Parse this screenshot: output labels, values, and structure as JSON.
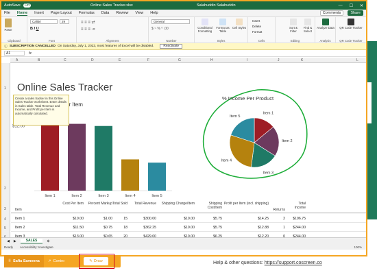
{
  "titlebar": {
    "autosave": "AutoSave",
    "autosave_state": "Off",
    "filename": "Online Sales Tracker.xlsx",
    "user": "Salahuddin Salahuddin"
  },
  "tabs": [
    "File",
    "Home",
    "Insert",
    "Page Layout",
    "Formulas",
    "Data",
    "Review",
    "View",
    "Help"
  ],
  "tabs_right": {
    "comments": "Comments",
    "share": "Share"
  },
  "ribbon": {
    "clipboard": {
      "label": "Clipboard",
      "paste": "Paste"
    },
    "font": {
      "label": "Font",
      "name": "Calibri",
      "size": "29"
    },
    "alignment": {
      "label": "Alignment"
    },
    "number": {
      "label": "Number",
      "format": "General"
    },
    "styles": {
      "label": "Styles",
      "conditional": "Conditional Formatting",
      "format_table": "Format as Table",
      "cell_styles": "Cell Styles"
    },
    "cells": {
      "label": "Cells",
      "insert": "Insert",
      "delete": "Delete",
      "format": "Format"
    },
    "editing": {
      "label": "Editing",
      "sort": "Sort & Filter",
      "find": "Find & Select"
    },
    "analysis": {
      "label": "Analysis",
      "analyze": "Analyze Data"
    },
    "qr": {
      "label": "QR Code Tracker",
      "btn": "QR Code Tracker"
    }
  },
  "notify": {
    "title": "SUBSCRIPTION CANCELLED",
    "message": "On Saturday, July 1, 2023, most features of Excel will be disabled.",
    "button": "Reactivate"
  },
  "formula_bar": {
    "namebox": "A1",
    "fx": "fx"
  },
  "columns": [
    "A",
    "B",
    "C",
    "D",
    "E",
    "F",
    "G",
    "H",
    "I",
    "J",
    "K",
    "L"
  ],
  "rows": [
    "1",
    "2",
    "3",
    "4",
    "5",
    "6"
  ],
  "sheet": {
    "title": "Online Sales Tracker",
    "tooltip": "Create a sales tracker in this Online Sales Tracker worksheet. Enter details in Sales table. Total Revenue and Income, and Profit per Item is automatically calculated.",
    "bar_title_partial": "er Item",
    "pie_title": "% Income Per Product"
  },
  "chart_data": [
    {
      "type": "bar",
      "title": "",
      "categories": [
        "Item 1",
        "Item 2",
        "Item 3",
        "Item 4",
        "Item 5"
      ],
      "values": [
        12.2,
        12.4,
        12.0,
        5.8,
        5.2
      ],
      "colors": [
        "#9e1d25",
        "#6d3a5e",
        "#1f7a66",
        "#b5820e",
        "#2b8ba0"
      ],
      "ylim": [
        0,
        14
      ],
      "visible_ytick": "$12.00"
    },
    {
      "type": "pie",
      "title": "% Income Per Product",
      "labels": [
        "Item 1",
        "Item 2",
        "Item 3",
        "Item 4",
        "Item 5"
      ],
      "values": [
        14,
        20,
        18,
        28,
        20
      ],
      "colors": [
        "#9e1d25",
        "#6d3a5e",
        "#1f7a66",
        "#b5820e",
        "#2b8ba0"
      ]
    }
  ],
  "table": {
    "headers": [
      "Item",
      "Cost Per Item",
      "Percent Markup",
      "Total Sold",
      "Total Revenue",
      "Shipping Charge/Item",
      "Shipping Cost/Item",
      "Profit per Item (incl. shipping)",
      "Returns",
      "Total Income"
    ],
    "rows": [
      [
        "Item 1",
        "$10.00",
        "$1.00",
        "15",
        "$300.00",
        "$10.00",
        "$5.75",
        "$14.25",
        "2",
        "$196.75"
      ],
      [
        "Item 2",
        "$11.50",
        "$0.75",
        "18",
        "$362.25",
        "$10.00",
        "$5.75",
        "$12.88",
        "1",
        "$244.00"
      ],
      [
        "Item 3",
        "$13.00",
        "$0.65",
        "20",
        "$429.00",
        "$10.00",
        "$6.25",
        "$12.20",
        "0",
        "$244.00"
      ]
    ]
  },
  "sheettab": "SALES",
  "status": {
    "ready": "Ready",
    "access": "Accessibility: Investigate",
    "zoom": "100%"
  },
  "taskbar": {
    "user": "Safia Sameena",
    "control": "Contro",
    "draw": "Draw"
  },
  "help": {
    "text": "Help & other questions: ",
    "link": "https://support.coscreen.co"
  }
}
